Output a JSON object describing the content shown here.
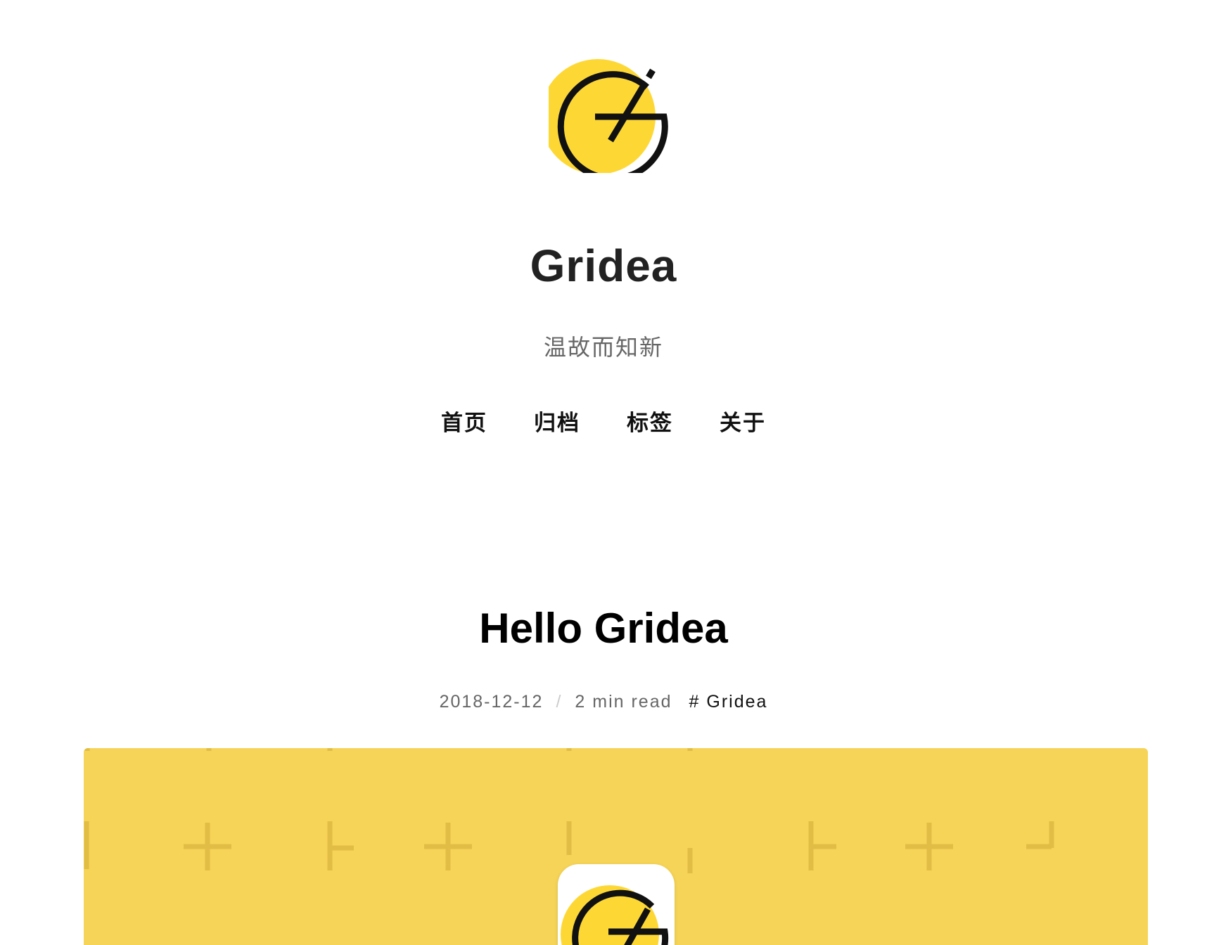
{
  "site": {
    "logo": {
      "icon": "gridea-logo-icon",
      "accent_color": "#fdd835",
      "stroke_color": "#111111"
    },
    "title": "Gridea",
    "description": "温故而知新"
  },
  "nav": {
    "items": [
      {
        "label": "首页"
      },
      {
        "label": "归档"
      },
      {
        "label": "标签"
      },
      {
        "label": "关于"
      }
    ]
  },
  "post": {
    "title": "Hello Gridea",
    "date": "2018-12-12",
    "separator": "/",
    "read_time": "2 min read",
    "tag": "# Gridea",
    "feature_image": {
      "background_color": "#f6d457",
      "pattern_color": "#e2bd46",
      "icon": "gridea-app-icon"
    }
  }
}
